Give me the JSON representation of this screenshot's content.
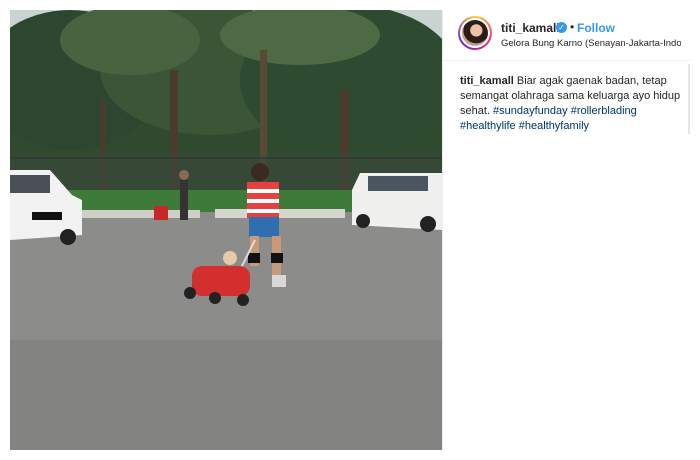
{
  "post": {
    "username": "titi_kamall",
    "verified_icon": "check-icon",
    "separator": "•",
    "follow_label": "Follow",
    "location": "Gelora Bung Karno (Senayan-Jakarta-Indo..."
  },
  "caption": {
    "username": "titi_kamall",
    "text_1": "Biar agak gaenak badan, tetap semangat olahraga sama keluarga",
    "emoji": "",
    "text_2": "ayo hidup sehat.",
    "hashtags": [
      "#sundayfunday",
      "#rollerblading",
      "#healthylife",
      "#healthyfamily"
    ]
  },
  "colors": {
    "link_blue": "#3897f0",
    "hashtag": "#003569",
    "text": "#262626"
  }
}
